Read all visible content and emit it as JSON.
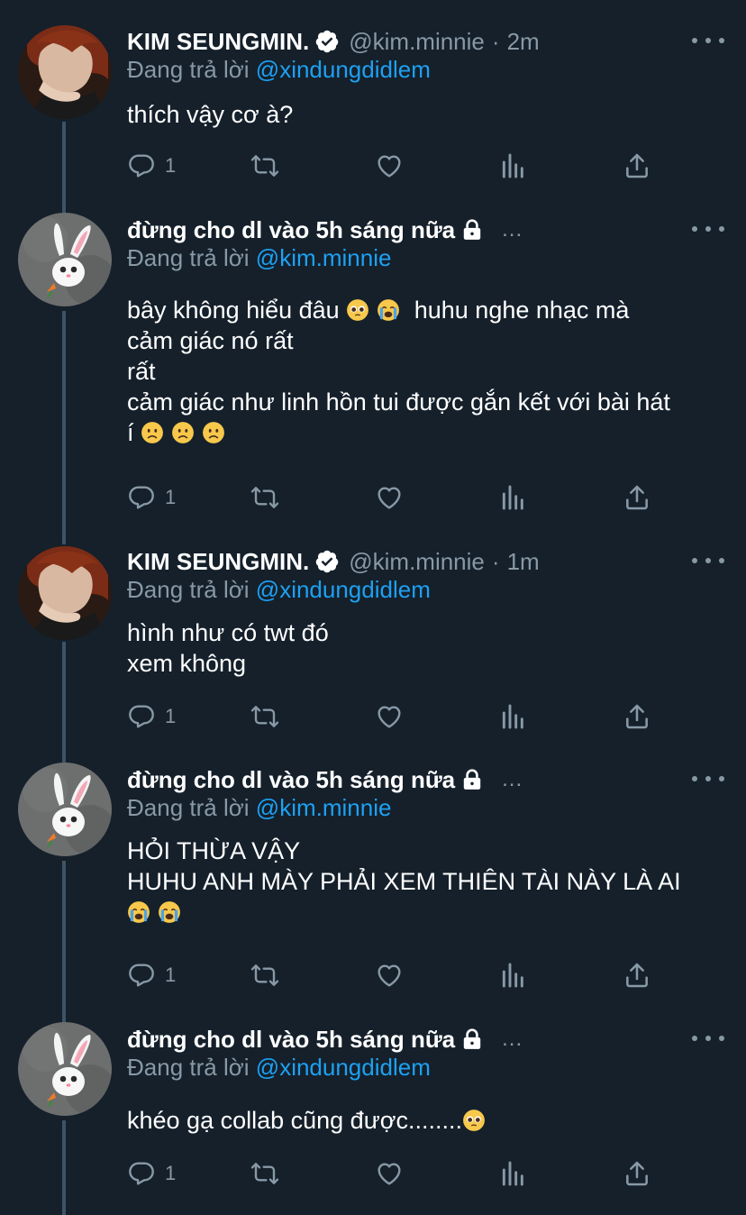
{
  "colors": {
    "background": "#15202b",
    "text": "#ffffff",
    "muted": "#8899a6",
    "link": "#1da1f2",
    "thread_line": "#3d5466"
  },
  "replying_label": "Đang trả lời",
  "tweets": [
    {
      "name": "KIM SEUNGMIN.",
      "badge": "verified-icon",
      "handle": "@kim.minnie",
      "dot": "·",
      "time": "2m",
      "reply_to": "@xindungdidlem",
      "lines": [
        "thích vậy cơ à?"
      ],
      "reply_count": "1"
    },
    {
      "name": "đừng cho dl vào 5h sáng nữa",
      "badge": "lock-icon",
      "handle_truncated": "...",
      "reply_to": "@kim.minnie",
      "lines": [
        "bây không hiểu đâu",
        "huhu nghe nhạc mà",
        "cảm giác nó rất",
        "rất",
        "cảm giác như linh hồn tui được gắn kết với bài hát",
        "í"
      ],
      "reply_count": "1"
    },
    {
      "name": "KIM SEUNGMIN.",
      "badge": "verified-icon",
      "handle": "@kim.minnie",
      "dot": "·",
      "time": "1m",
      "reply_to": "@xindungdidlem",
      "lines": [
        "hình như có twt đó",
        "xem không"
      ],
      "reply_count": "1"
    },
    {
      "name": "đừng cho dl vào 5h sáng nữa",
      "badge": "lock-icon",
      "handle_truncated": "...",
      "reply_to": "@kim.minnie",
      "lines": [
        "HỎI THỪA VẬY",
        "HUHU ANH MÀY PHẢI XEM THIÊN TÀI NÀY LÀ AI"
      ],
      "reply_count": "1"
    },
    {
      "name": "đừng cho dl vào 5h sáng nữa",
      "badge": "lock-icon",
      "handle_truncated": "...",
      "reply_to": "@xindungdidlem",
      "lines": [
        "khéo gạ collab cũng được........"
      ],
      "reply_count": "1"
    }
  ]
}
